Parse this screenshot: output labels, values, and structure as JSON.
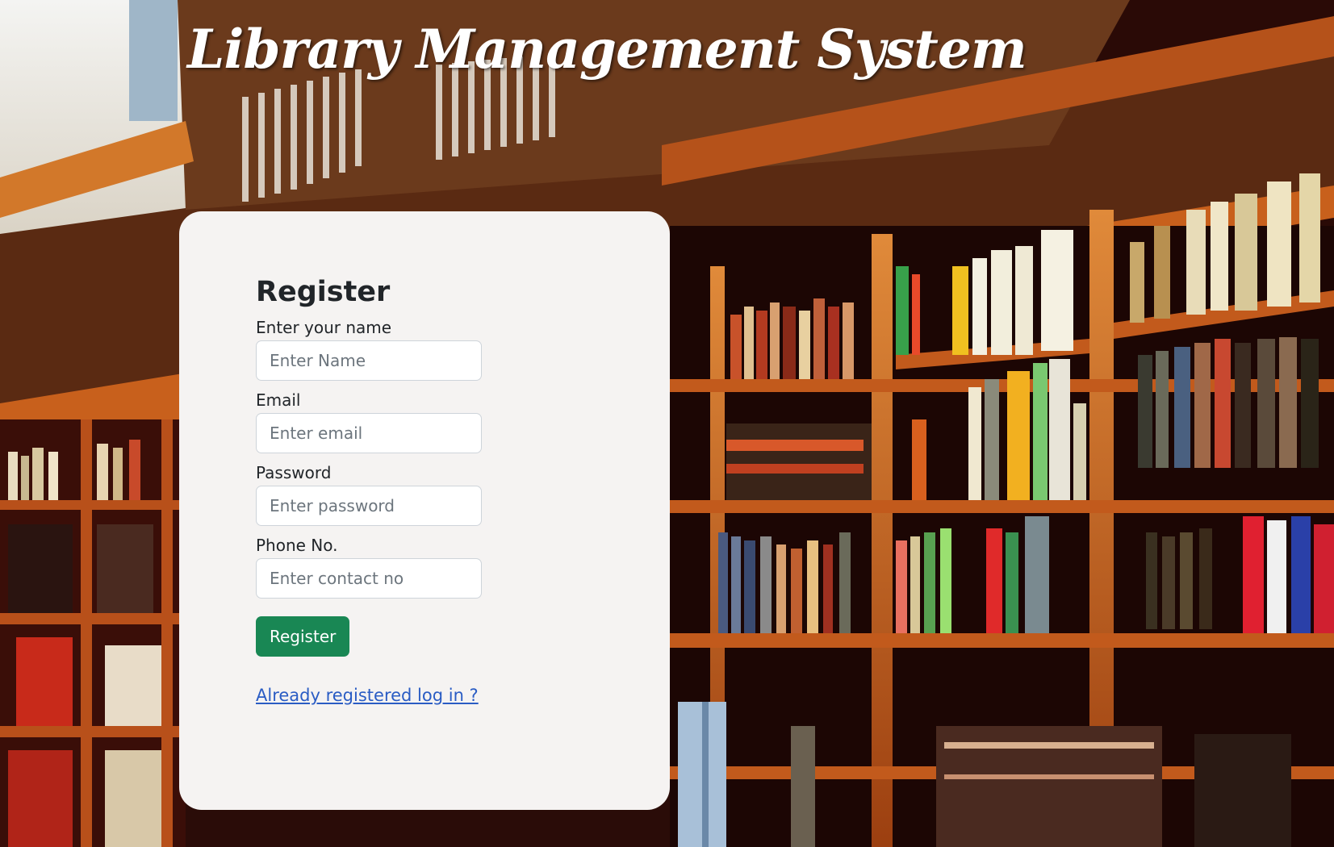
{
  "header": {
    "title": "Library Management System"
  },
  "register_form": {
    "heading": "Register",
    "fields": [
      {
        "label": "Enter your name",
        "placeholder": "Enter Name",
        "value": ""
      },
      {
        "label": "Email",
        "placeholder": "Enter email",
        "value": ""
      },
      {
        "label": "Password",
        "placeholder": "Enter password",
        "value": ""
      },
      {
        "label": "Phone No.",
        "placeholder": "Enter contact no",
        "value": ""
      }
    ],
    "submit_label": "Register",
    "login_link": "Already registered log in ?"
  },
  "colors": {
    "card_background": "#f5f3f2",
    "button_background": "#198754",
    "link": "#2a5cc4",
    "shelf_wood": "#b8561a",
    "shelf_dark": "#1a0604"
  }
}
